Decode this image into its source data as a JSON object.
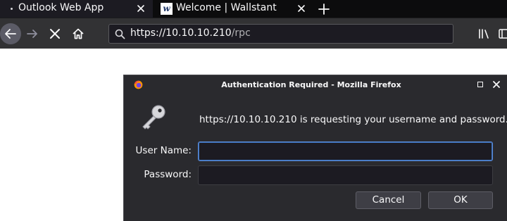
{
  "tabs": [
    {
      "label": "Outlook Web App",
      "icon": "dot-icon"
    },
    {
      "label": "Welcome | Wallstant",
      "icon": "wallstant-logo",
      "logo_letter": "w"
    }
  ],
  "toolbar": {
    "url_host": "https://10.10.10.210",
    "url_path": "/rpc"
  },
  "dialog": {
    "title": "Authentication Required - Mozilla Firefox",
    "message": "https://10.10.10.210 is requesting your username and password.",
    "username_label": "User Name:",
    "username_value": "",
    "password_label": "Password:",
    "password_value": "",
    "cancel_label": "Cancel",
    "ok_label": "OK"
  },
  "colors": {
    "chrome_dark": "#0c0c0d",
    "toolbar": "#323234",
    "dialog_bg": "#2a2a2e",
    "focus_ring": "#5a8bd6"
  }
}
